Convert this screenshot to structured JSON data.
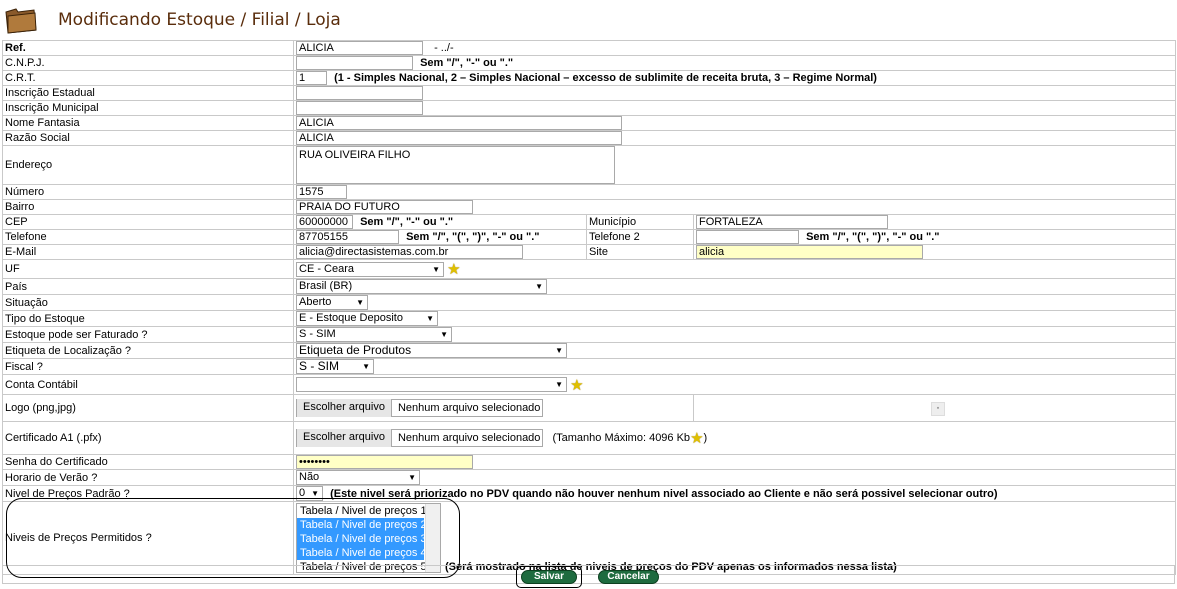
{
  "page": {
    "title": "Modificando Estoque / Filial / Loja"
  },
  "fields": {
    "ref": {
      "label": "Ref.",
      "value": "ALICIA",
      "suffix": "- ../-"
    },
    "cnpj": {
      "label": "C.N.P.J.",
      "value": "",
      "hint": "Sem \"/\", \"-\" ou \".\""
    },
    "crt": {
      "label": "C.R.T.",
      "value": "1",
      "hint": "(1 - Simples Nacional, 2 – Simples Nacional – excesso de sublimite de receita bruta, 3 – Regime Normal)"
    },
    "inscricao_estadual": {
      "label": "Inscrição Estadual",
      "value": ""
    },
    "inscricao_municipal": {
      "label": "Inscrição Municipal",
      "value": ""
    },
    "nome_fantasia": {
      "label": "Nome Fantasia",
      "value": "ALICIA"
    },
    "razao_social": {
      "label": "Razão Social",
      "value": "ALICIA"
    },
    "endereco": {
      "label": "Endereço",
      "value": "RUA OLIVEIRA FILHO"
    },
    "numero": {
      "label": "Número",
      "value": "1575"
    },
    "bairro": {
      "label": "Bairro",
      "value": "PRAIA DO FUTURO"
    },
    "cep": {
      "label": "CEP",
      "value": "60000000",
      "hint": "Sem \"/\", \"-\" ou \".\""
    },
    "municipio": {
      "label": "Município",
      "value": "FORTALEZA"
    },
    "telefone": {
      "label": "Telefone",
      "value": "87705155",
      "hint": "Sem \"/\", \"(\", \")\", \"-\" ou \".\""
    },
    "telefone2": {
      "label": "Telefone 2",
      "value": "",
      "hint": "Sem \"/\", \"(\", \")\", \"-\" ou \".\""
    },
    "email": {
      "label": "E-Mail",
      "value": "alicia@directasistemas.com.br"
    },
    "site": {
      "label": "Site",
      "value": "alicia"
    },
    "uf": {
      "label": "UF",
      "value": "CE - Ceara"
    },
    "pais": {
      "label": "País",
      "value": "Brasil (BR)"
    },
    "situacao": {
      "label": "Situação",
      "value": "Aberto"
    },
    "tipo_estoque": {
      "label": "Tipo do Estoque",
      "value": "E - Estoque Deposito"
    },
    "faturado": {
      "label": "Estoque pode ser Faturado ?",
      "value": "S - SIM"
    },
    "etiqueta": {
      "label": "Etiqueta de Localização ?",
      "value": "Etiqueta de Produtos"
    },
    "fiscal": {
      "label": "Fiscal ?",
      "value": "S - SIM"
    },
    "conta_contabil": {
      "label": "Conta Contábil",
      "value": ""
    },
    "logo": {
      "label": "Logo (png,jpg)",
      "button": "Escolher arquivo",
      "status": "Nenhum arquivo selecionado"
    },
    "certificado": {
      "label": "Certificado A1 (.pfx)",
      "button": "Escolher arquivo",
      "status": "Nenhum arquivo selecionado",
      "hint_pre": "(Tamanho Máximo: 4096 Kb",
      "hint_post": ")"
    },
    "senha": {
      "label": "Senha do Certificado",
      "value": "••••••••"
    },
    "horario_verao": {
      "label": "Horario de Verão ?",
      "value": "Não"
    },
    "nivel_padrao": {
      "label": "Nivel de Preços Padrão ?",
      "value": "0",
      "hint": "(Este nivel será priorizado no PDV quando não houver nenhum nivel associado ao Cliente e não será possivel selecionar outro)"
    },
    "niveis": {
      "label": "Niveis de Preços Permitidos ?",
      "options": [
        {
          "label": "Tabela / Nivel de preços 1",
          "selected": false
        },
        {
          "label": "Tabela / Nivel de preços 2",
          "selected": true
        },
        {
          "label": "Tabela / Nivel de preços 3",
          "selected": true
        },
        {
          "label": "Tabela / Nivel de preços 4",
          "selected": true
        },
        {
          "label": "Tabela / Nivel de preços 5",
          "selected": false
        }
      ],
      "hint": "(Será mostrado na lista de niveis de preços do PDV apenas os informados nessa lista)"
    }
  },
  "buttons": {
    "save": "Salvar",
    "cancel": "Cancelar"
  },
  "colors": {
    "title": "#5a2d0c",
    "button": "#1e6b3f",
    "highlight": "#ffffc6",
    "selected": "#3399ff"
  }
}
